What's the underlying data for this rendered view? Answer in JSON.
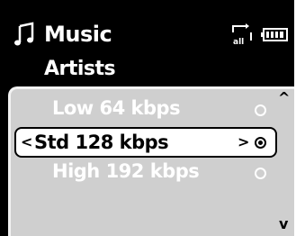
{
  "header": {
    "title": "Music",
    "title_icon": "music-note-icon",
    "repeat_icon": "repeat-all-icon",
    "battery_icon": "battery-icon"
  },
  "subtitle": "Artists",
  "list": {
    "items": [
      {
        "label": "Low 64 kbps",
        "selected": false
      },
      {
        "label": "Std 128 kbps",
        "selected": true
      },
      {
        "label": "High 192 kbps",
        "selected": false
      }
    ],
    "left_arrow": "<",
    "right_arrow": ">",
    "scroll_up": "^",
    "scroll_down": "v"
  },
  "colors": {
    "screen_bg": "#000000",
    "list_bg": "#cfcfcf",
    "text": "#ffffff",
    "selection_bg": "#ffffff"
  }
}
